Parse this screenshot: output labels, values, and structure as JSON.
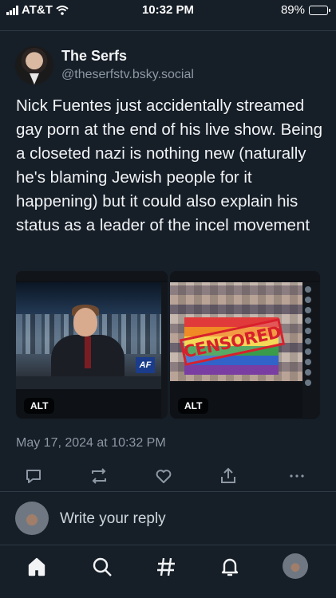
{
  "status_bar": {
    "carrier": "AT&T",
    "time": "10:32 PM",
    "battery": "89%",
    "battery_level": 0.89
  },
  "post": {
    "author_name": "The Serfs",
    "author_handle": "@theserfstv.bsky.social",
    "text": "Nick Fuentes just accidentally streamed gay porn at the end of his live show. Being a closeted nazi is nothing new (naturally he's blaming Jewish people for it happening) but it could also explain his status as a leader of the incel movement",
    "images": [
      {
        "alt_badge": "ALT",
        "overlay_text": "AF"
      },
      {
        "alt_badge": "ALT",
        "overlay_text": "CENSORED"
      }
    ],
    "date": "May 17, 2024 at 10:32 PM"
  },
  "actions": [
    "reply-icon",
    "repost-icon",
    "like-icon",
    "share-icon",
    "more-icon"
  ],
  "reply": {
    "placeholder": "Write your reply"
  },
  "bottom_nav": [
    "home-icon",
    "search-icon",
    "feeds-hash-icon",
    "notifications-bell-icon",
    "profile-avatar"
  ],
  "colors": {
    "background": "#161e27",
    "text": "#f1f3f5",
    "muted": "#8d98a5",
    "divider": "#2e3a47"
  }
}
